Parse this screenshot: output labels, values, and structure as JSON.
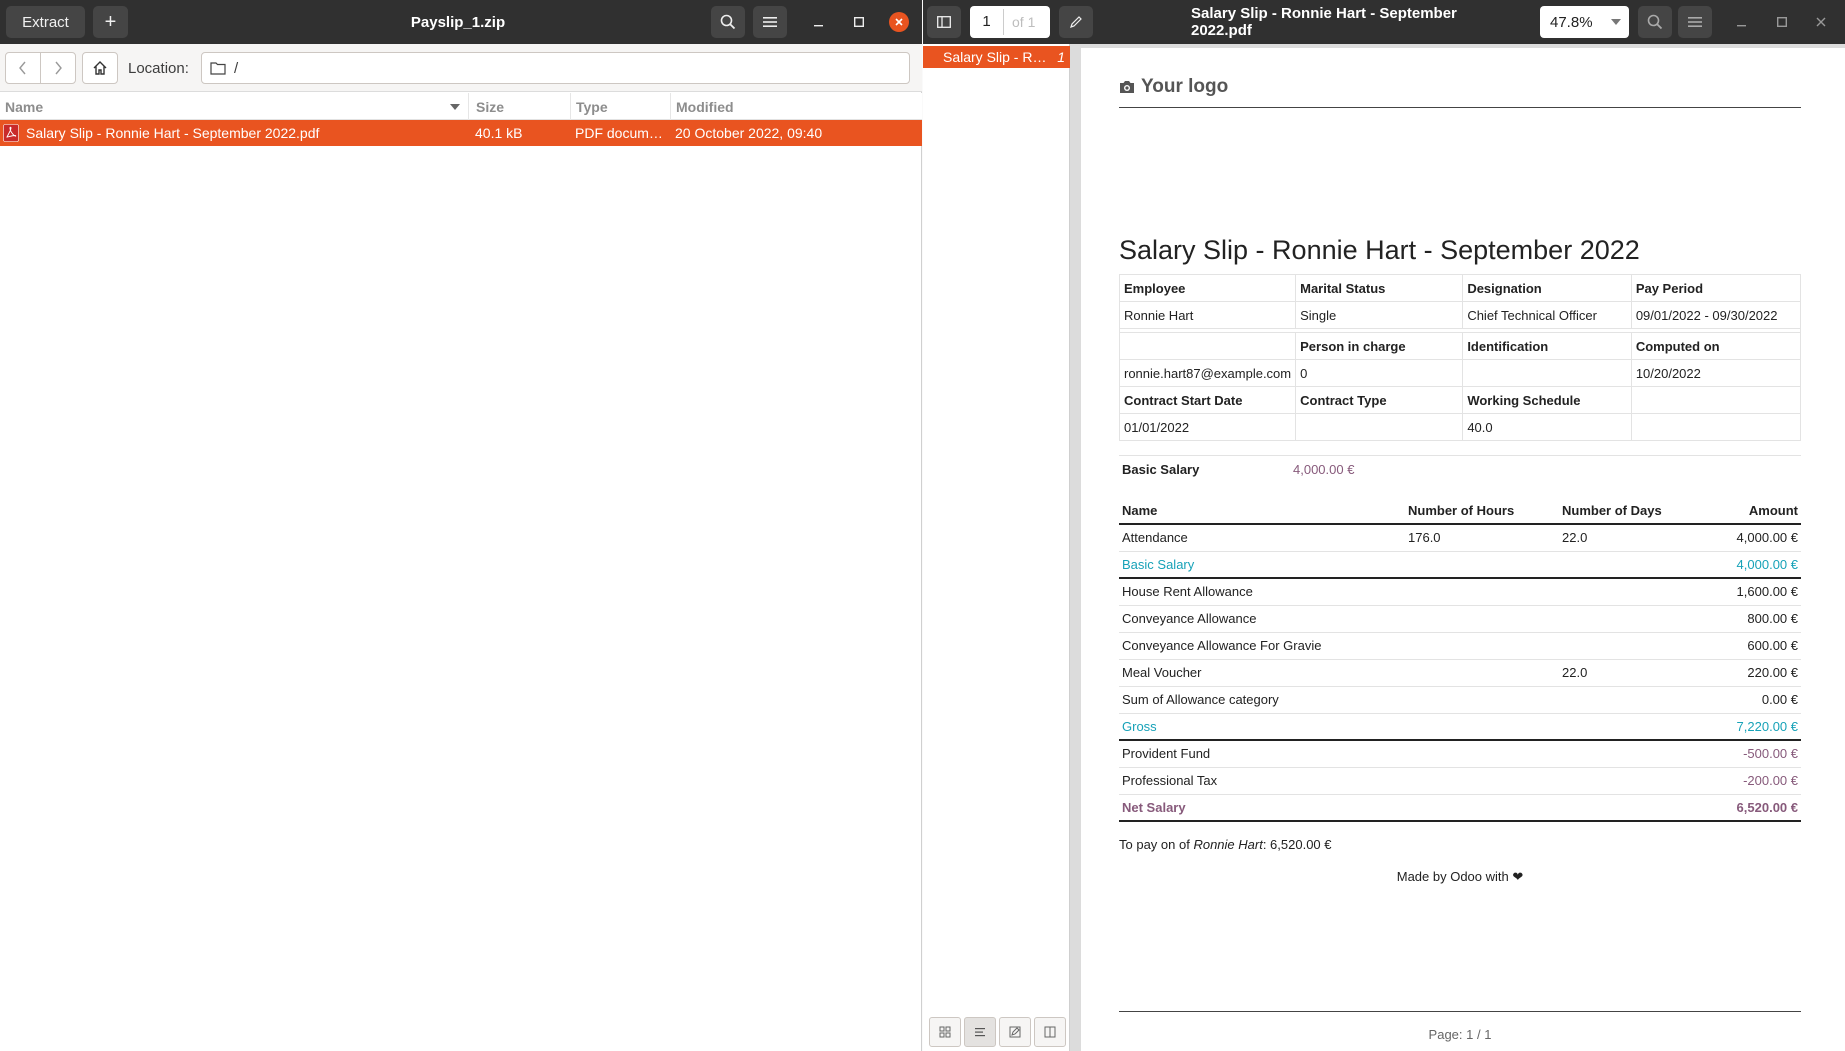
{
  "archive": {
    "title": "Payslip_1.zip",
    "extract_label": "Extract",
    "add_label": "+",
    "location_label": "Location:",
    "location_path": "/",
    "columns": [
      "Name",
      "Size",
      "Type",
      "Modified"
    ],
    "files": [
      {
        "name": "Salary Slip - Ronnie Hart - September 2022.pdf",
        "size": "40.1 kB",
        "type": "PDF docum…",
        "modified": "20 October 2022, 09:40"
      }
    ]
  },
  "viewer": {
    "title": "Salary Slip - Ronnie Hart - September 2022.pdf",
    "page_current": "1",
    "page_of": "of 1",
    "zoom": "47.8%",
    "thumb_label": "Salary Slip - R…",
    "thumb_page": "1"
  },
  "payslip": {
    "logo_text": "Your logo",
    "title": "Salary Slip - Ronnie Hart - September 2022",
    "info_rows": [
      [
        "Employee",
        "Marital Status",
        "Designation",
        "Pay Period"
      ],
      [
        "Ronnie Hart",
        "Single",
        "Chief Technical Officer",
        "09/01/2022 - 09/30/2022"
      ],
      [
        "",
        "Person in charge",
        "Identification",
        "Computed on"
      ],
      [
        "ronnie.hart87@example.com",
        "0",
        "",
        "10/20/2022"
      ],
      [
        "Contract Start Date",
        "Contract Type",
        "Working Schedule",
        ""
      ],
      [
        "01/01/2022",
        "",
        "40.0",
        ""
      ]
    ],
    "basic_label": "Basic Salary",
    "basic_value": "4,000.00 €",
    "line_headers": [
      "Name",
      "Number of Hours",
      "Number of Days",
      "Amount"
    ],
    "lines": [
      {
        "name": "Attendance",
        "hours": "176.0",
        "days": "22.0",
        "amount": "4,000.00 €",
        "kind": "normal"
      },
      {
        "name": "Basic Salary",
        "hours": "",
        "days": "",
        "amount": "4,000.00 €",
        "kind": "cat"
      },
      {
        "name": "House Rent Allowance",
        "hours": "",
        "days": "",
        "amount": "1,600.00 €",
        "kind": "normal"
      },
      {
        "name": "Conveyance Allowance",
        "hours": "",
        "days": "",
        "amount": "800.00 €",
        "kind": "normal"
      },
      {
        "name": "Conveyance Allowance For Gravie",
        "hours": "",
        "days": "",
        "amount": "600.00 €",
        "kind": "normal"
      },
      {
        "name": "Meal Voucher",
        "hours": "",
        "days": "22.0",
        "amount": "220.00 €",
        "kind": "normal"
      },
      {
        "name": "Sum of Allowance category",
        "hours": "",
        "days": "",
        "amount": "0.00 €",
        "kind": "normal"
      },
      {
        "name": "Gross",
        "hours": "",
        "days": "",
        "amount": "7,220.00 €",
        "kind": "cat"
      },
      {
        "name": "Provident Fund",
        "hours": "",
        "days": "",
        "amount": "-500.00 €",
        "kind": "neg"
      },
      {
        "name": "Professional Tax",
        "hours": "",
        "days": "",
        "amount": "-200.00 €",
        "kind": "neg"
      },
      {
        "name": "Net Salary",
        "hours": "",
        "days": "",
        "amount": "6,520.00 €",
        "kind": "net"
      }
    ],
    "to_pay_prefix": "To pay on of ",
    "to_pay_name": "Ronnie Hart",
    "to_pay_suffix": ": 6,520.00 €",
    "made_by": "Made by Odoo with ❤",
    "page_footer": "Page: 1 / 1"
  }
}
